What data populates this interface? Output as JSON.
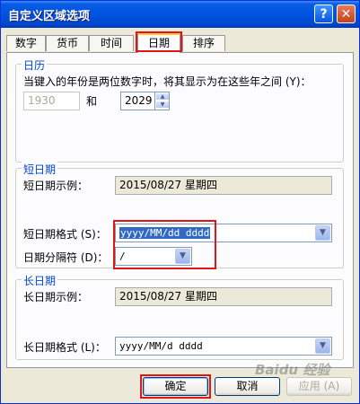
{
  "window": {
    "title": "自定义区域选项",
    "help_label": "?",
    "close_label": "✕"
  },
  "tabs": [
    {
      "label": "数字"
    },
    {
      "label": "货币"
    },
    {
      "label": "时间"
    },
    {
      "label": "日期",
      "active": true
    },
    {
      "label": "排序"
    }
  ],
  "calendar": {
    "title": "日历",
    "description": "当键入的年份是两位数字时，将其显示为在这些年之间 (Y)：",
    "from_year": "1930",
    "and_label": "和",
    "to_year": "2029"
  },
  "short_date": {
    "title": "短日期",
    "sample_label": "短日期示例：",
    "sample_value": "2015/08/27 星期四",
    "format_label": "短日期格式 (S)：",
    "format_value": "yyyy/MM/dd dddd",
    "separator_label": "日期分隔符 (D)：",
    "separator_value": "/"
  },
  "long_date": {
    "title": "长日期",
    "sample_label": "长日期示例：",
    "sample_value": "2015/08/27 星期四",
    "format_label": "长日期格式 (L)：",
    "format_value": "yyyy/MM/d dddd"
  },
  "buttons": {
    "ok": "确定",
    "cancel": "取消",
    "apply": "应用 (A)"
  },
  "watermark": "Baidu 经验",
  "colors": {
    "titlebar": "#0054E3",
    "group_title": "#0046D5",
    "highlight": "#E01616",
    "selection": "#316AC5"
  }
}
